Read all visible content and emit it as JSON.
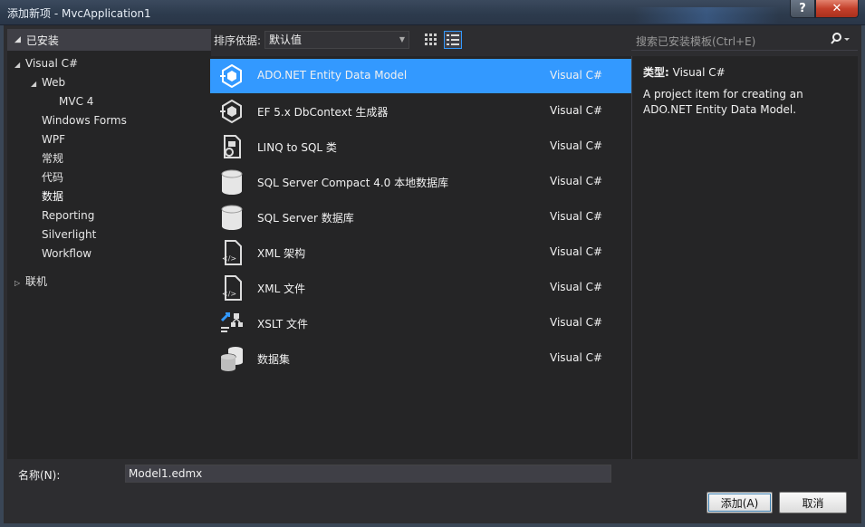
{
  "window": {
    "title": "添加新项 - MvcApplication1",
    "help_label": "?",
    "close_label": "✕"
  },
  "left_panel": {
    "header": "已安装",
    "tree": [
      {
        "label": "Visual C#",
        "level": 0,
        "expanded": true
      },
      {
        "label": "Web",
        "level": 1,
        "expanded": true
      },
      {
        "label": "MVC 4",
        "level": 2
      },
      {
        "label": "Windows Forms",
        "level": 1
      },
      {
        "label": "WPF",
        "level": 1
      },
      {
        "label": "常规",
        "level": 1
      },
      {
        "label": "代码",
        "level": 1
      },
      {
        "label": "数据",
        "level": 1,
        "selected": true
      },
      {
        "label": "Reporting",
        "level": 1
      },
      {
        "label": "Silverlight",
        "level": 1
      },
      {
        "label": "Workflow",
        "level": 1
      },
      {
        "label": "联机",
        "level": 0,
        "expanded": false
      }
    ]
  },
  "sortbar": {
    "label": "排序依据:",
    "value": "默认值"
  },
  "search": {
    "placeholder": "搜索已安装模板(Ctrl+E)"
  },
  "items": [
    {
      "name": "ADO.NET Entity Data Model",
      "lang": "Visual C#",
      "icon": "entity-model-icon",
      "selected": true
    },
    {
      "name": "EF 5.x DbContext 生成器",
      "lang": "Visual C#",
      "icon": "dbcontext-generator-icon"
    },
    {
      "name": "LINQ to SQL 类",
      "lang": "Visual C#",
      "icon": "linq-to-sql-icon"
    },
    {
      "name": "SQL Server Compact 4.0 本地数据库",
      "lang": "Visual C#",
      "icon": "database-icon"
    },
    {
      "name": "SQL Server 数据库",
      "lang": "Visual C#",
      "icon": "database-icon"
    },
    {
      "name": "XML 架构",
      "lang": "Visual C#",
      "icon": "xml-schema-icon"
    },
    {
      "name": "XML 文件",
      "lang": "Visual C#",
      "icon": "xml-file-icon"
    },
    {
      "name": "XSLT 文件",
      "lang": "Visual C#",
      "icon": "xslt-file-icon"
    },
    {
      "name": "数据集",
      "lang": "Visual C#",
      "icon": "dataset-icon"
    }
  ],
  "details": {
    "type_label": "类型:",
    "type_value": "Visual C#",
    "description": "A project item for creating an ADO.NET Entity Data Model."
  },
  "bottom": {
    "name_label": "名称(N):",
    "name_value": "Model1.edmx",
    "add_label": "添加(A)",
    "cancel_label": "取消"
  },
  "colors": {
    "accent": "#3399ff",
    "background": "#2d2d30",
    "panel": "#252526"
  }
}
